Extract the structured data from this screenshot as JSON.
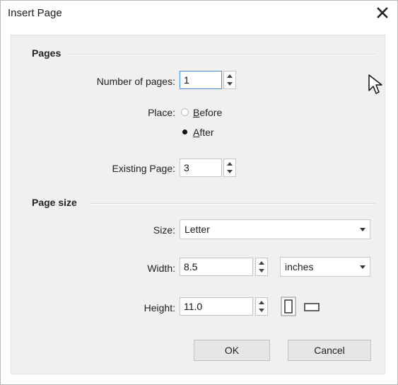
{
  "window": {
    "title": "Insert Page"
  },
  "pages": {
    "section_title": "Pages",
    "number_of_pages_label": "Number of pages:",
    "number_of_pages_value": "1",
    "place_label": "Place:",
    "before_label_mnemonic": "B",
    "before_label_rest": "efore",
    "after_label_mnemonic": "A",
    "after_label_rest": "fter",
    "place_selected": "After",
    "existing_page_label": "Existing Page:",
    "existing_page_value": "3"
  },
  "page_size": {
    "section_title": "Page size",
    "size_label": "Size:",
    "size_value": "Letter",
    "width_label": "Width:",
    "width_value": "8.5",
    "units_value": "inches",
    "height_label": "Height:",
    "height_value": "11.0",
    "orientation_selected": "portrait"
  },
  "buttons": {
    "ok": "OK",
    "cancel": "Cancel"
  },
  "icons": {
    "close": "close-icon",
    "spinner": "spin-arrows-icon",
    "dropdown": "chevron-down-icon",
    "portrait": "portrait-page-icon",
    "landscape": "landscape-page-icon",
    "cursor": "mouse-pointer-icon"
  }
}
